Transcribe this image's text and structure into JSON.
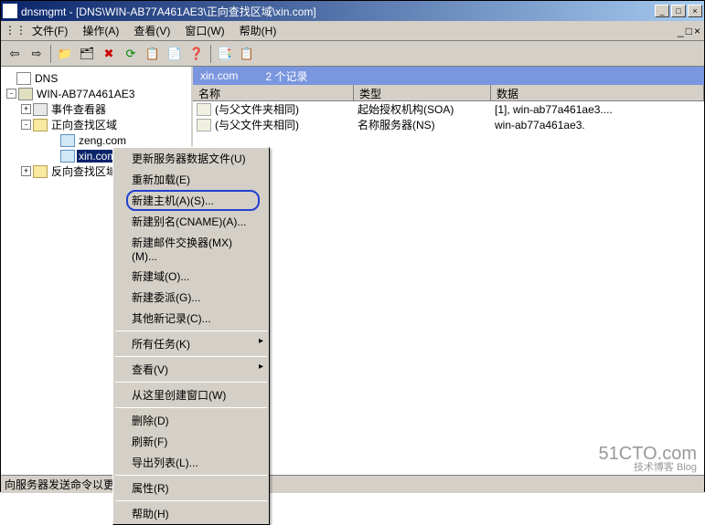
{
  "window": {
    "title": "dnsmgmt - [DNS\\WIN-AB77A461AE3\\正向查找区域\\xin.com]",
    "min": "_",
    "max": "□",
    "close": "×"
  },
  "menu": {
    "file": "文件(F)",
    "action": "操作(A)",
    "view": "查看(V)",
    "window": "窗口(W)",
    "help": "帮助(H)"
  },
  "tree": {
    "root": "DNS",
    "server": "WIN-AB77A461AE3",
    "eventviewer": "事件查看器",
    "forward": "正向查找区域",
    "zone1": "zeng.com",
    "zone2": "xin.com",
    "reverse": "反向查找区域"
  },
  "zone_header": {
    "name": "xin.com",
    "count": "2 个记录"
  },
  "columns": {
    "name": "名称",
    "type": "类型",
    "data": "数据"
  },
  "records": [
    {
      "name": "(与父文件夹相同)",
      "type": "起始授权机构(SOA)",
      "data": "[1], win-ab77a461ae3...."
    },
    {
      "name": "(与父文件夹相同)",
      "type": "名称服务器(NS)",
      "data": "win-ab77a461ae3."
    }
  ],
  "context_menu": {
    "update": "更新服务器数据文件(U)",
    "reload": "重新加载(E)",
    "newhost": "新建主机(A)(S)...",
    "newalias": "新建别名(CNAME)(A)...",
    "newmx": "新建邮件交换器(MX)(M)...",
    "newdomain": "新建域(O)...",
    "newdelegation": "新建委派(G)...",
    "otherrecords": "其他新记录(C)...",
    "alltasks": "所有任务(K)",
    "view": "查看(V)",
    "newwindow": "从这里创建窗口(W)",
    "delete": "删除(D)",
    "refresh": "刷新(F)",
    "export": "导出列表(L)...",
    "properties": "属性(R)",
    "help": "帮助(H)"
  },
  "status": "向服务器发送命令以更新此区域文件。",
  "watermark": {
    "main": "51CTO.com",
    "sub": "技术博客   Blog"
  }
}
